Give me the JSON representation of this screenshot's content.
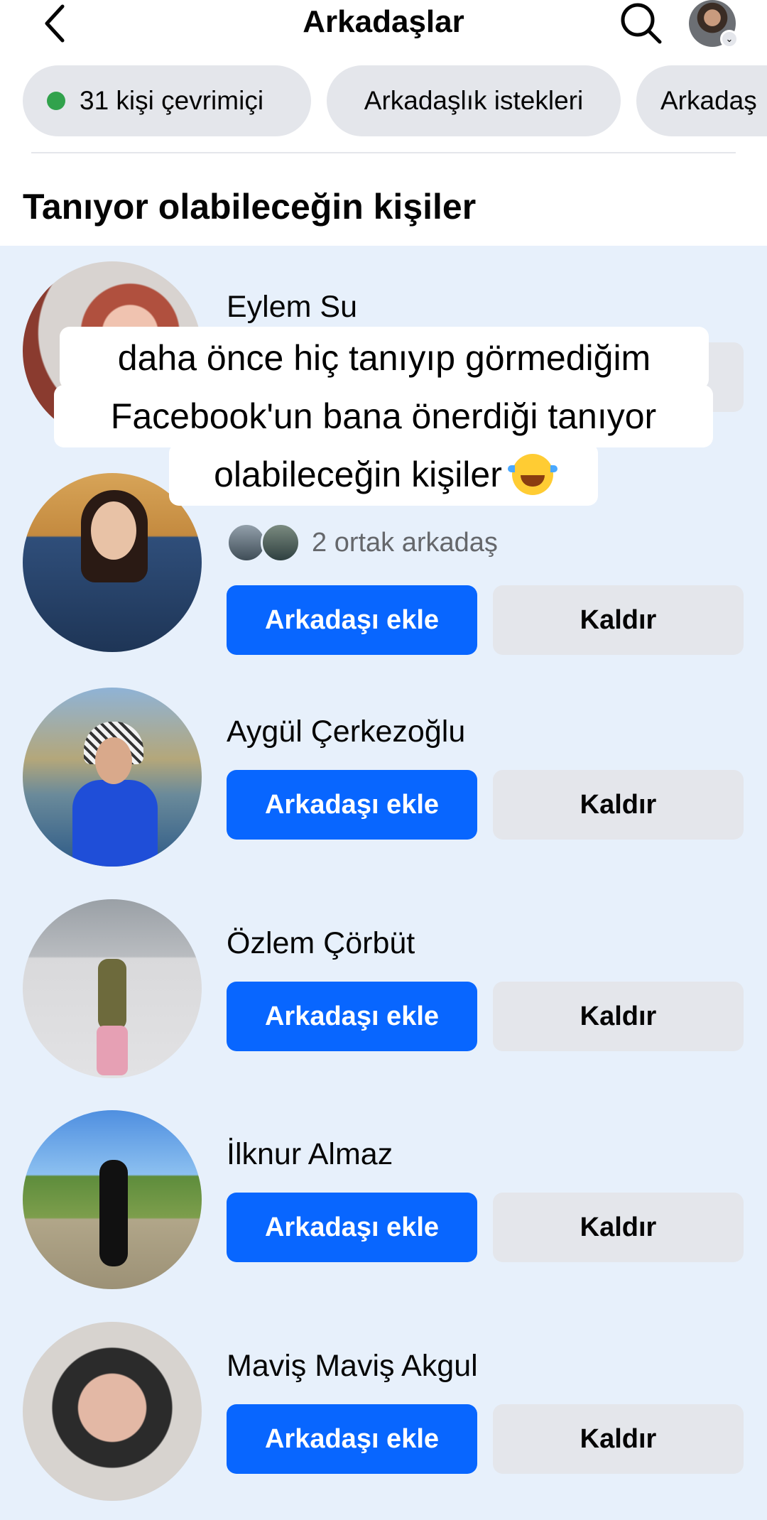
{
  "header": {
    "title": "Arkadaşlar"
  },
  "chips": [
    {
      "label": "31 kişi çevrimiçi"
    },
    {
      "label": "Arkadaşlık istekleri"
    },
    {
      "label": "Arkadaş"
    }
  ],
  "section_title": "Tanıyor olabileceğin kişiler",
  "overlay": {
    "line1": "daha önce hiç tanıyıp görmediğim",
    "line2": "Facebook'un bana önerdiği tanıyor",
    "line3": "olabileceğin kişiler"
  },
  "people": [
    {
      "name": "Eylem Su"
    },
    {
      "name": "",
      "mutual": "2 ortak arkadaş"
    },
    {
      "name": "Aygül Çerkezoğlu"
    },
    {
      "name": "Özlem Çörbüt"
    },
    {
      "name": "İlknur Almaz"
    },
    {
      "name": "Maviş Maviş Akgul"
    }
  ],
  "buttons": {
    "add_label": "Arkadaşı ekle",
    "remove_label": "Kaldır"
  },
  "colors": {
    "primary": "#0866ff",
    "secondary_bg": "#e4e6eb",
    "list_bg": "#e7f0fb",
    "online_dot": "#31a24c"
  }
}
